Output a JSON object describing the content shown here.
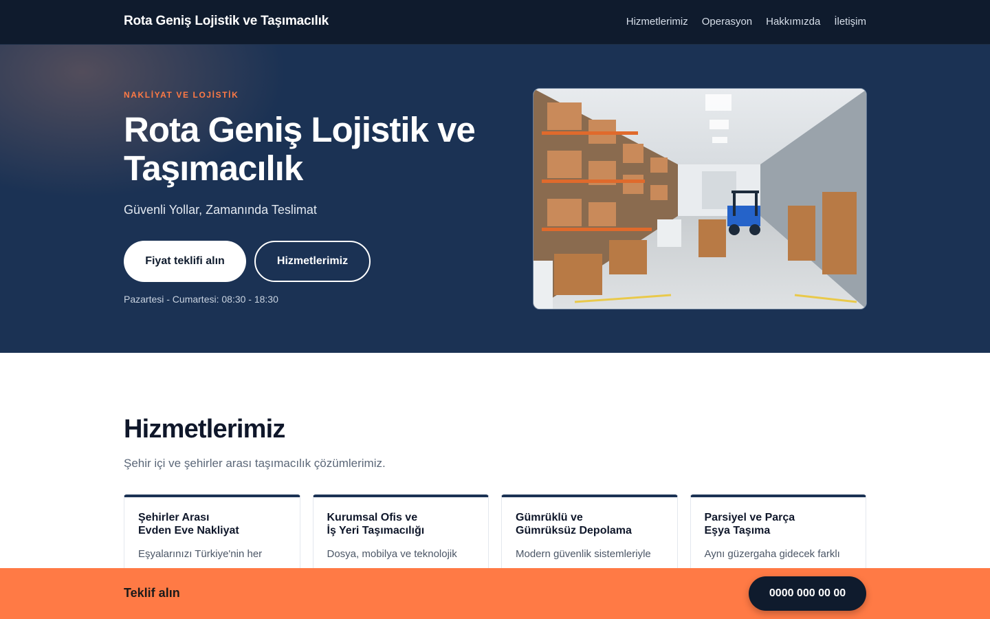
{
  "header": {
    "brand": "Rota Geniş Lojistik ve Taşımacılık",
    "nav": [
      "Hizmetlerimiz",
      "Operasyon",
      "Hakkımızda",
      "İletişim"
    ]
  },
  "hero": {
    "eyebrow": "NAKLİYAT VE LOJİSTİK",
    "title": "Rota Geniş Lojistik ve Taşımacılık",
    "subtitle": "Güvenli Yollar, Zamanında Teslimat",
    "primary_button": "Fiyat teklifi alın",
    "secondary_button": "Hizmetlerimiz",
    "hours": "Pazartesi - Cumartesi: 08:30 - 18:30"
  },
  "services": {
    "title": "Hizmetlerimiz",
    "subtitle": "Şehir içi ve şehirler arası taşımacılık çözümlerimiz.",
    "cards": [
      {
        "title": "Şehirler Arası\nEvden Eve Nakliyat",
        "text": "Eşyalarınızı Türkiye'nin her"
      },
      {
        "title": "Kurumsal Ofis ve\nİş Yeri Taşımacılığı",
        "text": "Dosya, mobilya ve teknolojik"
      },
      {
        "title": "Gümrüklü ve\nGümrüksüz Depolama",
        "text": "Modern güvenlik sistemleriyle"
      },
      {
        "title": "Parsiyel ve Parça\nEşya Taşıma",
        "text": "Aynı güzergaha gidecek farklı"
      }
    ]
  },
  "cta": {
    "label": "Teklif alın",
    "phone": "0000 000 00 00"
  },
  "colors": {
    "navy": "#1b3254",
    "dark": "#0f1b2d",
    "accent": "#ff7a45"
  }
}
